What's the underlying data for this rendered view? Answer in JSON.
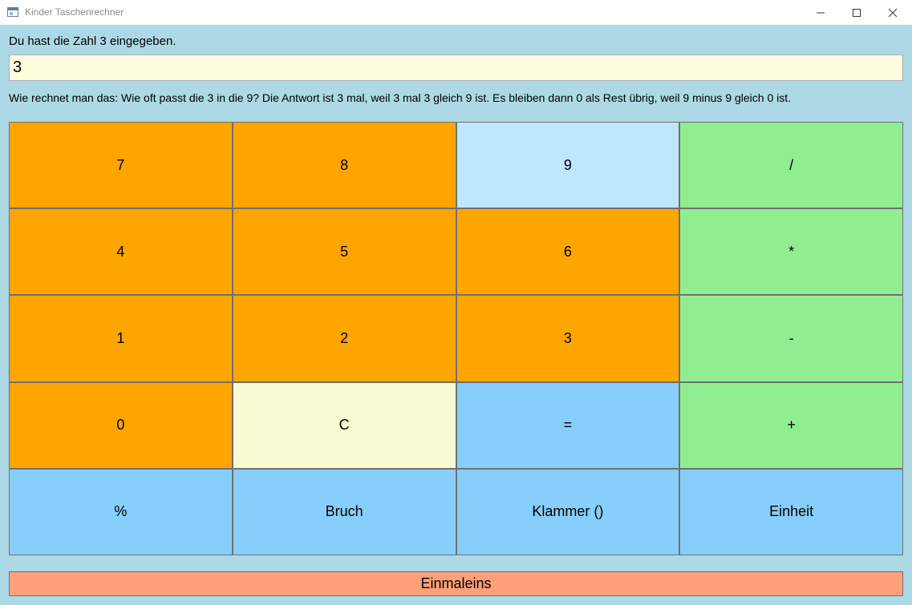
{
  "window": {
    "title": "Kinder Taschenrechner",
    "icon": "app-window-icon",
    "controls": {
      "minimize": "minimize-icon",
      "maximize": "maximize-icon",
      "close": "close-icon"
    }
  },
  "status_text": "Du hast die Zahl 3 eingegeben.",
  "display": {
    "value": "3"
  },
  "explanation": "Wie rechnet man das: Wie oft passt die 3 in die 9? Die Antwort ist 3 mal, weil 3 mal 3 gleich 9 ist. Es bleiben dann 0 als Rest übrig, weil 9 minus 9 gleich 0 ist.",
  "keypad": [
    {
      "label": "7",
      "color": "#FFA500"
    },
    {
      "label": "8",
      "color": "#FFA500"
    },
    {
      "label": "9",
      "color": "#BEE6FD",
      "state": "hover"
    },
    {
      "label": "/",
      "color": "#90EE90"
    },
    {
      "label": "4",
      "color": "#FFA500"
    },
    {
      "label": "5",
      "color": "#FFA500"
    },
    {
      "label": "6",
      "color": "#FFA500"
    },
    {
      "label": "*",
      "color": "#90EE90"
    },
    {
      "label": "1",
      "color": "#FFA500"
    },
    {
      "label": "2",
      "color": "#FFA500"
    },
    {
      "label": "3",
      "color": "#FFA500"
    },
    {
      "label": "-",
      "color": "#90EE90"
    },
    {
      "label": "0",
      "color": "#FFA500"
    },
    {
      "label": "C",
      "color": "#FAFAD2"
    },
    {
      "label": "=",
      "color": "#87CEFA"
    },
    {
      "label": "+",
      "color": "#90EE90"
    },
    {
      "label": "%",
      "color": "#87CEFA"
    },
    {
      "label": "Bruch",
      "color": "#87CEFA"
    },
    {
      "label": "Klammer ()",
      "color": "#87CEFA"
    },
    {
      "label": "Einheit",
      "color": "#87CEFA"
    }
  ],
  "einmaleins": {
    "label": "Einmaleins",
    "color": "#FFA07A"
  },
  "colors": {
    "background": "#ADD8E6",
    "display_background": "#FFFFE0"
  }
}
